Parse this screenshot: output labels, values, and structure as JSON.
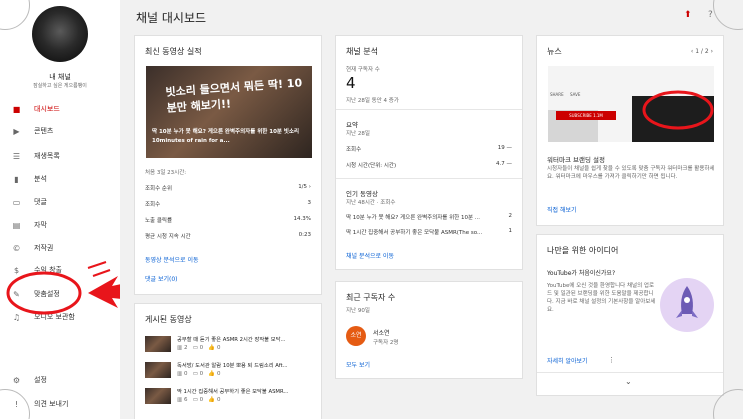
{
  "page_title": "채널 대시보드",
  "channel": {
    "name": "내 채널",
    "subtitle": "잠실하고 싶은 게으름뱅이"
  },
  "sidebar": {
    "items": [
      {
        "label": "대시보드",
        "icon": "dashboard-icon",
        "active": true
      },
      {
        "label": "콘텐츠",
        "icon": "video-icon"
      },
      {
        "label": "재생목록",
        "icon": "playlist-icon"
      },
      {
        "label": "분석",
        "icon": "analytics-icon"
      },
      {
        "label": "댓글",
        "icon": "comments-icon"
      },
      {
        "label": "자막",
        "icon": "subtitles-icon"
      },
      {
        "label": "저작권",
        "icon": "copyright-icon"
      },
      {
        "label": "수익 창출",
        "icon": "money-icon"
      },
      {
        "label": "맞춤설정",
        "icon": "customize-icon"
      },
      {
        "label": "오디오 보관함",
        "icon": "audio-library-icon"
      }
    ],
    "bottom": [
      {
        "label": "설정",
        "icon": "gear-icon"
      },
      {
        "label": "의견 보내기",
        "icon": "feedback-icon"
      }
    ]
  },
  "latest_video": {
    "title": "최신 동영상 실적",
    "thumb_text": "빗소리 들으면서 뭐든 딱! 10분만 해보기!!",
    "caption": "딱 10분 누가 못 해요? 게으른 완벽주의자를 위한 10분 빗소리 10minutes of rain for a...",
    "first_period": "처음 3일 23시간:",
    "stats": [
      {
        "label": "조회수 순위",
        "value": "1/5 ›"
      },
      {
        "label": "조회수",
        "value": "3"
      },
      {
        "label": "노출 클릭률",
        "value": "14.3%"
      },
      {
        "label": "평균 시청 지속 시간",
        "value": "0:23"
      }
    ],
    "link_analytics": "동영상 분석으로 이동",
    "link_comments": "댓글 보기(0)"
  },
  "published": {
    "title": "게시된 동영상",
    "items": [
      {
        "title": "공부할 때 듣기 좋은 ASMR 2시간 장작불 모닥...",
        "views": "2",
        "comments": "0",
        "likes": "0"
      },
      {
        "title": "독서방/ 도서관 알람 10분 뽀용 퇴 드림소리 Aft...",
        "views": "0",
        "comments": "0",
        "likes": "0"
      },
      {
        "title": "딱 1시간 집중해서 공부하기 좋은 모닥불 ASMR...",
        "views": "6",
        "comments": "0",
        "likes": "0"
      }
    ]
  },
  "analytics": {
    "title": "채널 분석",
    "subs_label": "현재 구독자 수",
    "subs_value": "4",
    "subs_change": "지난 28일 동안 4 증가",
    "summary_title": "요약",
    "summary_period": "지난 28일",
    "summary": [
      {
        "label": "조회수",
        "value": "19 —"
      },
      {
        "label": "시청 시간(단위: 시간)",
        "value": "4.7 —"
      }
    ],
    "popular_title": "인기 동영상",
    "popular_period": "지난 48시간 · 조회수",
    "popular": [
      {
        "label": "딱 10분 누가 못 해요? 게으른 완벽주의자를 위한 10분 ...",
        "value": "2"
      },
      {
        "label": "딱 1시간 집중해서 공부하기 좋은 모닥불 ASMR(The so...",
        "value": "1"
      }
    ],
    "link": "채널 분석으로 이동"
  },
  "subscribers": {
    "title": "최근 구독자 수",
    "period": "지난 90일",
    "avatar_text": "소연",
    "name": "서소연",
    "count": "구독자 2명",
    "link": "모두 보기"
  },
  "news": {
    "title": "뉴스",
    "pager": "1 / 2",
    "headline": "워터마크 브랜딩 설정",
    "body": "시청자들이 채널을 쉽게 찾을 수 있도록 맞춤 구독자 워터마크를 활용하세요. 워터마크에 마우스를 가져가 클릭하기만 하면 됩니다.",
    "link": "직접 해보기",
    "img_subscribe": "SUBSCRIBE 1.1M",
    "img_share": "SHARE",
    "img_save": "SAVE"
  },
  "ideas": {
    "title": "나만을 위한 아이디어",
    "question": "YouTube가 처음이신가요?",
    "body": "YouTube에 오신 것을 환영합니다 채널의 업로드 및 일관된 브랜딩을 위한 도움말을 제공합니다. 지금 바로 채널 설정의 기본사항을 알아보세요.",
    "link": "자세히 알아보기"
  },
  "colors": {
    "accent": "#cc0000",
    "link": "#065fd4",
    "annotation": "#e8151b"
  }
}
